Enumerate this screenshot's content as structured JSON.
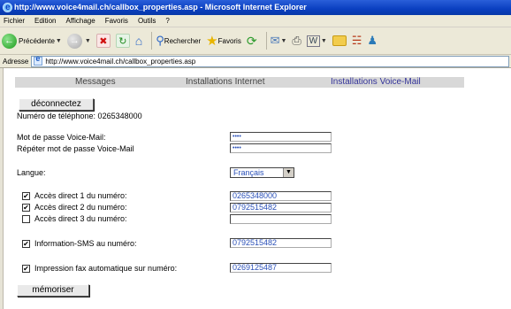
{
  "window": {
    "title": "http://www.voice4mail.ch/callbox_properties.asp - Microsoft Internet Explorer"
  },
  "menu": [
    "Fichier",
    "Edition",
    "Affichage",
    "Favoris",
    "Outils",
    "?"
  ],
  "toolbar": {
    "back_label": "Précédente",
    "search_label": "Rechercher",
    "favorites_label": "Favoris"
  },
  "address": {
    "label": "Adresse",
    "url": "http://www.voice4mail.ch/callbox_properties.asp"
  },
  "nav": {
    "messages": "Messages",
    "internet": "Installations Internet",
    "voicemail": "Installations Voice-Mail"
  },
  "page": {
    "disconnect_label": "déconnectez",
    "phone_line": "Numéro de téléphone: 0265348000",
    "password_label": "Mot de passe Voice-Mail:",
    "password_value": "••••",
    "password_repeat_label": "Répéter mot de passe Voice-Mail",
    "password_repeat_value": "••••",
    "language_label": "Langue:",
    "language_value": "Français",
    "direct1_label": "Accès direct 1 du numéro:",
    "direct1_value": "0265348000",
    "direct2_label": "Accès direct 2 du numéro:",
    "direct2_value": "0792515482",
    "direct3_label": "Accès direct 3 du numéro:",
    "direct3_value": "",
    "sms_label": "Information-SMS au numéro:",
    "sms_value": "0792515482",
    "fax_label": "Impression fax automatique sur numéro:",
    "fax_value": "0269125487",
    "save_label": "mémoriser"
  },
  "checkboxes": {
    "direct1": true,
    "direct2": true,
    "direct3": false,
    "sms": true,
    "fax": true
  }
}
